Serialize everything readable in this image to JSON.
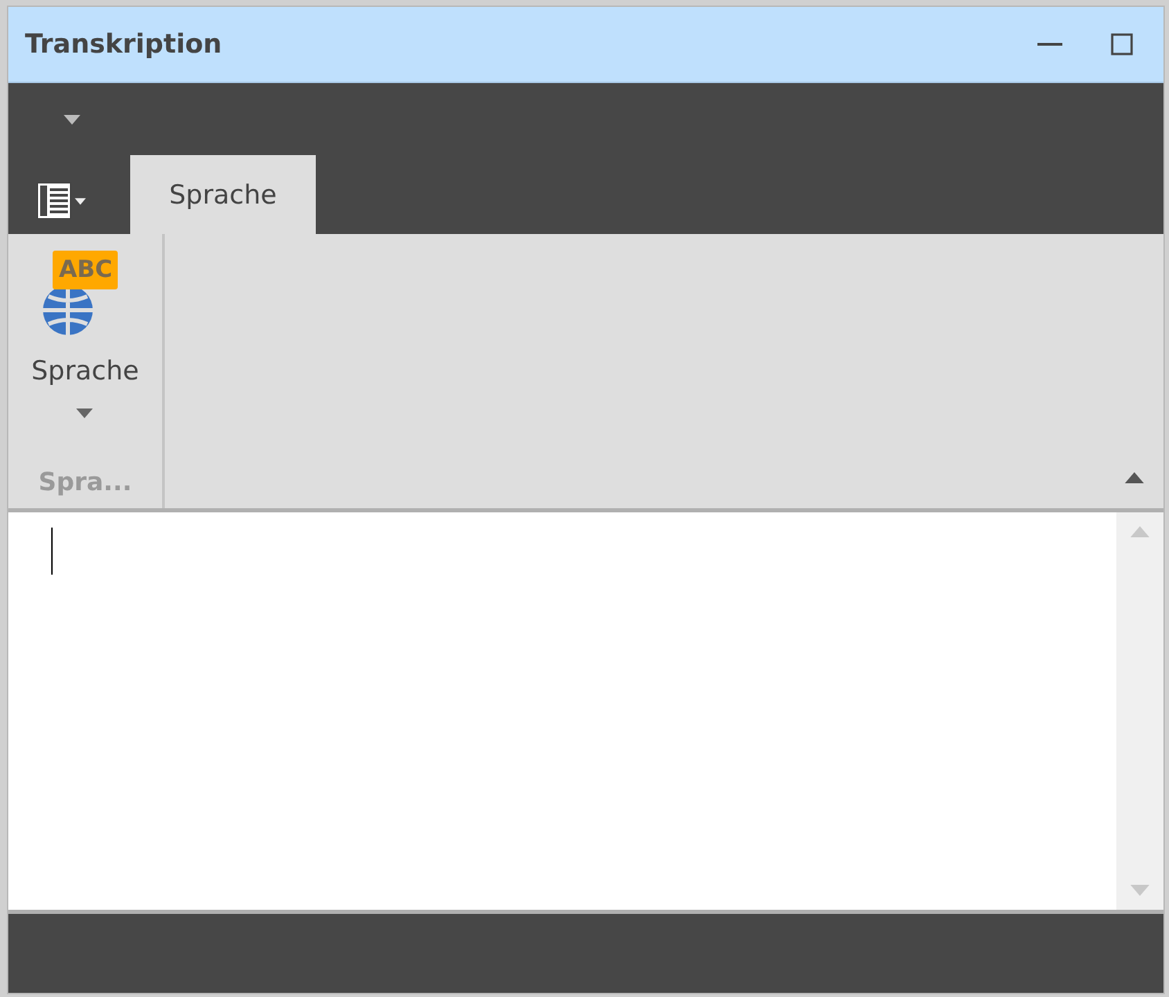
{
  "window": {
    "title": "Transkription"
  },
  "tabs": [
    {
      "label": "Sprache",
      "selected": true
    }
  ],
  "ribbon": {
    "groups": [
      {
        "label": "Spra...",
        "buttons": [
          {
            "label": "Sprache",
            "badge": "ABC"
          }
        ]
      }
    ]
  }
}
